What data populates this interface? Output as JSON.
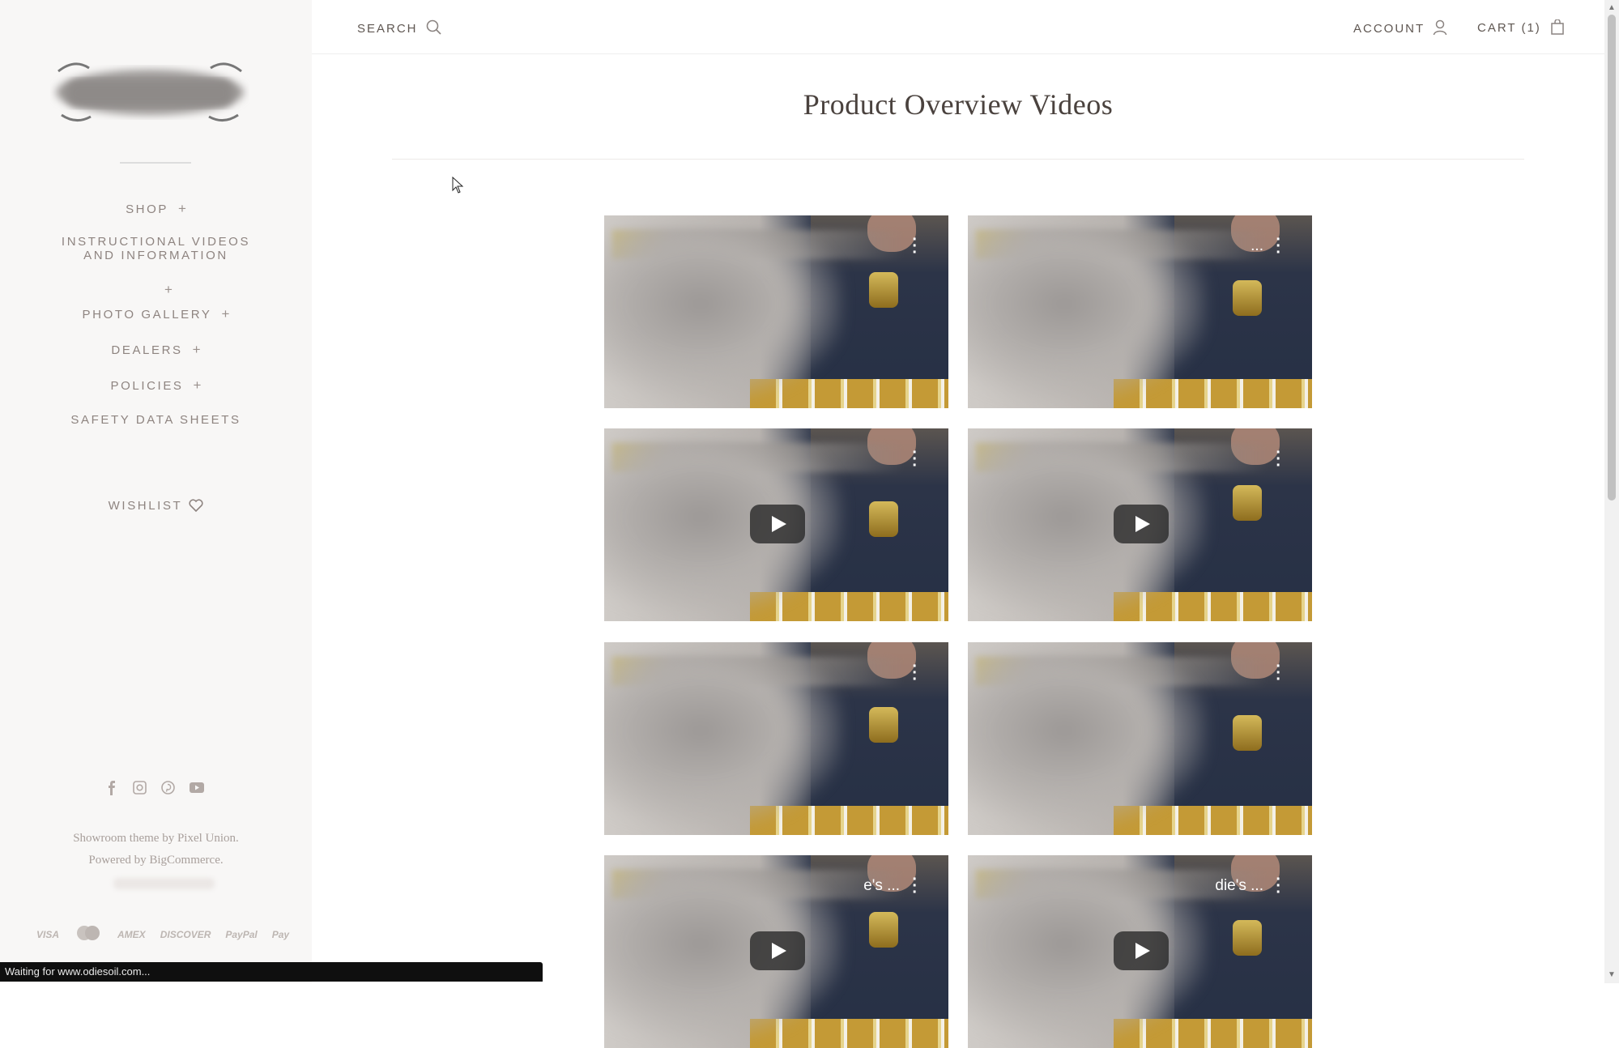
{
  "sidebar": {
    "nav": [
      {
        "label": "SHOP",
        "has_plus": true
      },
      {
        "label": "INSTRUCTIONAL VIDEOS AND INFORMATION",
        "has_plus": true
      },
      {
        "label": "PHOTO GALLERY",
        "has_plus": true
      },
      {
        "label": "DEALERS",
        "has_plus": true
      },
      {
        "label": "POLICIES",
        "has_plus": true
      },
      {
        "label": "SAFETY DATA SHEETS",
        "has_plus": false
      }
    ],
    "plus_symbol": "+",
    "wishlist_label": "WISHLIST",
    "social_icons": [
      "facebook-icon",
      "instagram-icon",
      "pinterest-icon",
      "youtube-icon"
    ],
    "credits": {
      "theme_text": "Showroom theme",
      "by": " by ",
      "theme_author": "Pixel Union",
      "theme_end": ".",
      "powered_text": "Powered by ",
      "powered_link": "BigCommerce",
      "powered_end": "."
    },
    "payments": [
      "VISA",
      "mastercard",
      "AMEX",
      "DISCOVER",
      "PayPal",
      "Pay"
    ]
  },
  "header": {
    "search_label": "SEARCH",
    "account_label": "ACCOUNT",
    "cart_label": "CART (1)"
  },
  "main": {
    "page_title": "Product Overview Videos",
    "videos": [
      {
        "title": ""
      },
      {
        "title": "..."
      },
      {
        "title": ""
      },
      {
        "title": ""
      },
      {
        "title": ""
      },
      {
        "title": ""
      },
      {
        "title": "e's ..."
      },
      {
        "title": "die's ..."
      }
    ]
  },
  "status_bar": {
    "text": "Waiting for www.odiesoil.com..."
  }
}
